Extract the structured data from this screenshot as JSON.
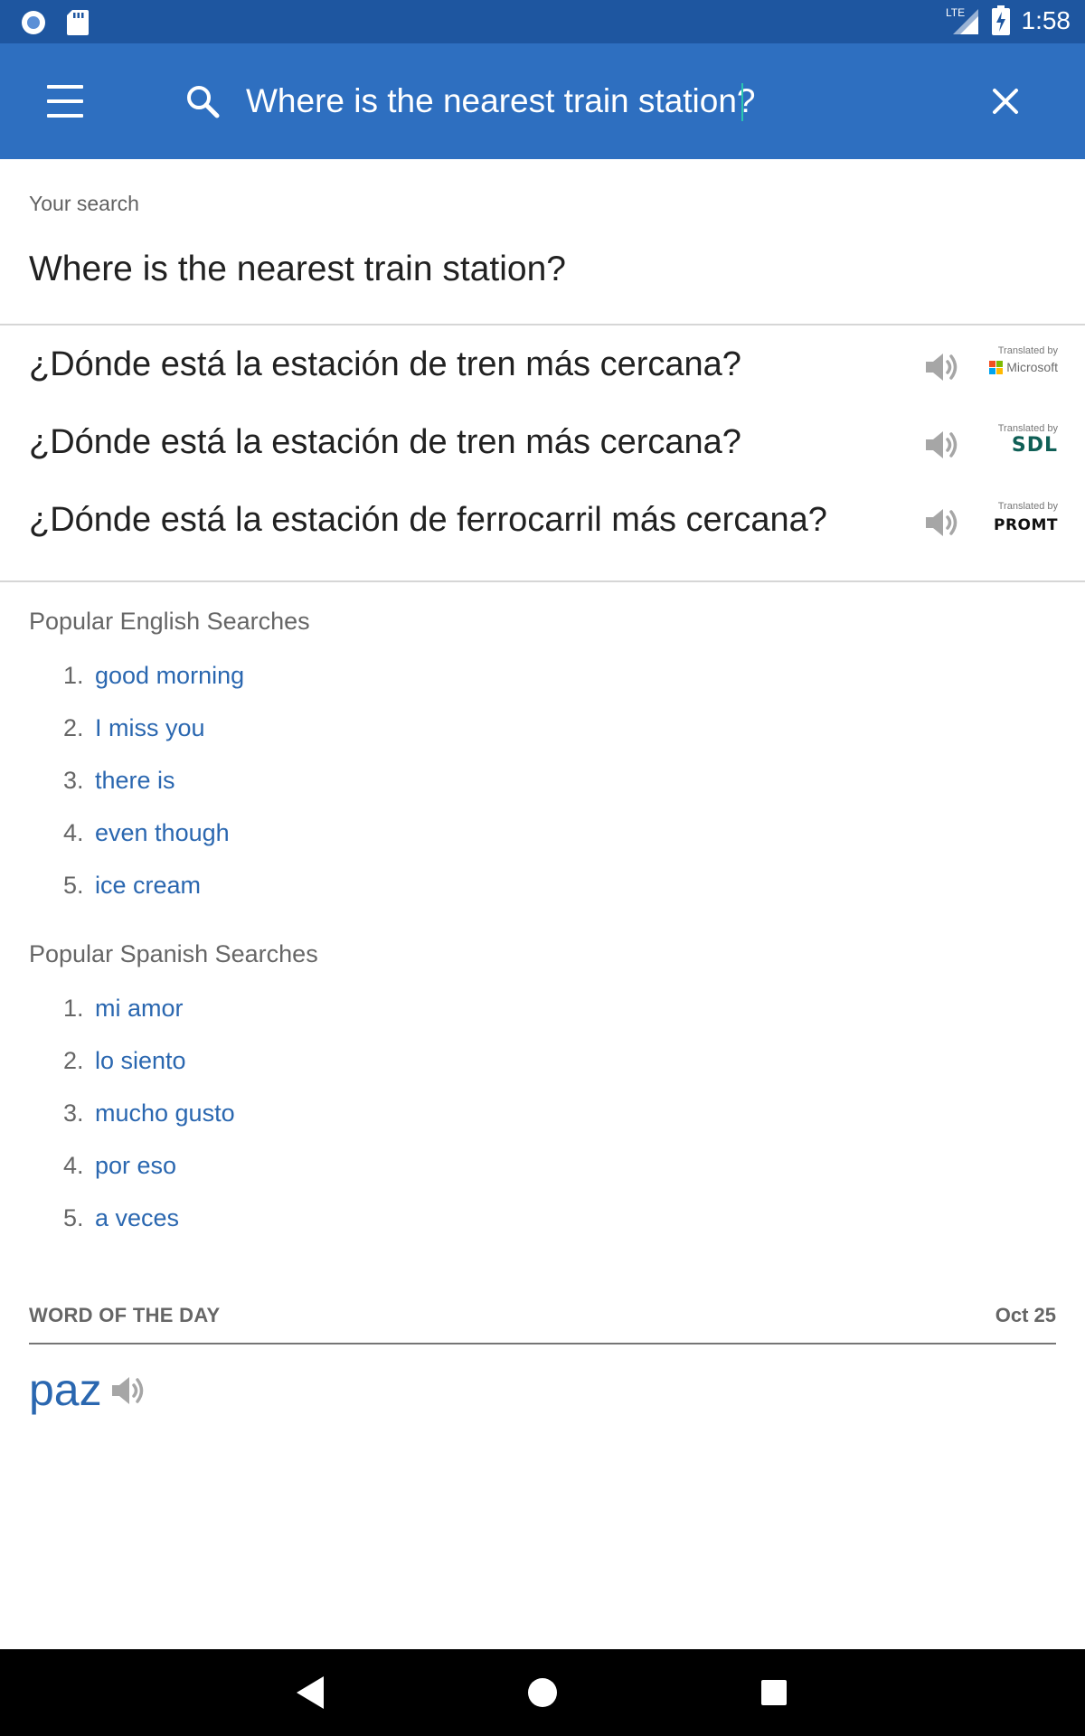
{
  "status_bar": {
    "network": "LTE",
    "time": "1:58"
  },
  "search": {
    "value": "Where is the nearest train station?",
    "icons": {
      "menu": "menu-icon",
      "search": "search-icon",
      "clear": "close-icon"
    }
  },
  "your_search": {
    "label": "Your search",
    "text": "Where is the nearest train station?"
  },
  "translations": [
    {
      "text": "¿Dónde está la estación de tren más cercana?",
      "provider_label": "Translated by",
      "provider": "Microsoft"
    },
    {
      "text": "¿Dónde está la estación de tren más cercana?",
      "provider_label": "Translated by",
      "provider": "SDL"
    },
    {
      "text": "¿Dónde está la estación de ferrocarril más cercana?",
      "provider_label": "Translated by",
      "provider": "PROMT"
    }
  ],
  "popular_english": {
    "title": "Popular English Searches",
    "items": [
      {
        "num": "1.",
        "text": "good morning"
      },
      {
        "num": "2.",
        "text": "I miss you"
      },
      {
        "num": "3.",
        "text": "there is"
      },
      {
        "num": "4.",
        "text": "even though"
      },
      {
        "num": "5.",
        "text": "ice cream"
      }
    ]
  },
  "popular_spanish": {
    "title": "Popular Spanish Searches",
    "items": [
      {
        "num": "1.",
        "text": "mi amor"
      },
      {
        "num": "2.",
        "text": "lo siento"
      },
      {
        "num": "3.",
        "text": "mucho gusto"
      },
      {
        "num": "4.",
        "text": "por eso"
      },
      {
        "num": "5.",
        "text": "a veces"
      }
    ]
  },
  "word_of_day": {
    "label": "WORD OF THE DAY",
    "date": "Oct 25",
    "word": "paz"
  },
  "colors": {
    "status_bar": "#1e56a0",
    "app_bar": "#2e6fc0",
    "link": "#2a67b0",
    "caret": "#29c6b0"
  }
}
